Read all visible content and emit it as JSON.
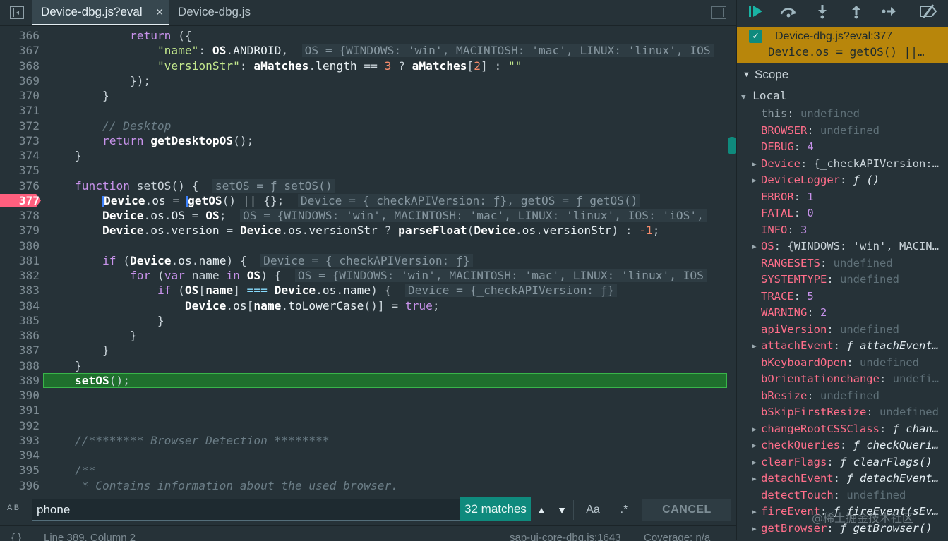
{
  "tabs": {
    "active": "Device-dbg.js?eval",
    "inactive": "Device-dbg.js",
    "close": "✕"
  },
  "editor": {
    "lines": [
      {
        "n": "366",
        "tokens": [
          [
            "pl",
            "            "
          ],
          [
            "kw",
            "return"
          ],
          [
            "pl",
            " ({"
          ]
        ]
      },
      {
        "n": "367",
        "tokens": [
          [
            "pl",
            "                "
          ],
          [
            "str",
            "\"name\""
          ],
          [
            "pl",
            ": "
          ],
          [
            "obj",
            "OS"
          ],
          [
            "pl",
            "."
          ],
          [
            "prop",
            "ANDROID"
          ],
          [
            "pl",
            ",  "
          ],
          [
            "inline",
            "OS = {WINDOWS: 'win', MACINTOSH: 'mac', LINUX: 'linux', IOS"
          ]
        ]
      },
      {
        "n": "368",
        "tokens": [
          [
            "pl",
            "                "
          ],
          [
            "str",
            "\"versionStr\""
          ],
          [
            "pl",
            ": "
          ],
          [
            "obj",
            "aMatches"
          ],
          [
            "pl",
            "."
          ],
          [
            "prop",
            "length"
          ],
          [
            "pl",
            " == "
          ],
          [
            "num",
            "3"
          ],
          [
            "pl",
            " ? "
          ],
          [
            "obj",
            "aMatches"
          ],
          [
            "pl",
            "["
          ],
          [
            "num",
            "2"
          ],
          [
            "pl",
            "] : "
          ],
          [
            "str",
            "\"\""
          ]
        ]
      },
      {
        "n": "369",
        "tokens": [
          [
            "pl",
            "            });"
          ]
        ]
      },
      {
        "n": "370",
        "tokens": [
          [
            "pl",
            "        }"
          ]
        ]
      },
      {
        "n": "371",
        "tokens": []
      },
      {
        "n": "372",
        "tokens": [
          [
            "pl",
            "        "
          ],
          [
            "cm",
            "// Desktop"
          ]
        ]
      },
      {
        "n": "373",
        "tokens": [
          [
            "pl",
            "        "
          ],
          [
            "kw",
            "return"
          ],
          [
            "pl",
            " "
          ],
          [
            "fn",
            "getDesktopOS"
          ],
          [
            "pl",
            "();"
          ]
        ]
      },
      {
        "n": "374",
        "tokens": [
          [
            "pl",
            "    }"
          ]
        ]
      },
      {
        "n": "375",
        "tokens": []
      },
      {
        "n": "376",
        "tokens": [
          [
            "pl",
            "    "
          ],
          [
            "kw",
            "function"
          ],
          [
            "pl",
            " setOS() {  "
          ],
          [
            "inline",
            "setOS = ƒ setOS()"
          ]
        ]
      },
      {
        "n": "377",
        "tokens": [
          [
            "pl",
            "        "
          ],
          [
            "cursor",
            ""
          ],
          [
            "obj",
            "Device"
          ],
          [
            "pl",
            "."
          ],
          [
            "prop",
            "os"
          ],
          [
            "pl",
            " = "
          ],
          [
            "cursor",
            ""
          ],
          [
            "fn",
            "getOS"
          ],
          [
            "pl",
            "() || {};  "
          ],
          [
            "inline",
            "Device = {_checkAPIVersion: ƒ}, getOS = ƒ getOS()"
          ]
        ]
      },
      {
        "n": "378",
        "tokens": [
          [
            "pl",
            "        "
          ],
          [
            "obj",
            "Device"
          ],
          [
            "pl",
            "."
          ],
          [
            "prop",
            "os"
          ],
          [
            "pl",
            "."
          ],
          [
            "prop",
            "OS"
          ],
          [
            "pl",
            " = "
          ],
          [
            "obj",
            "OS"
          ],
          [
            "pl",
            ";  "
          ],
          [
            "inline",
            "OS = {WINDOWS: 'win', MACINTOSH: 'mac', LINUX: 'linux', IOS: 'iOS',"
          ]
        ]
      },
      {
        "n": "379",
        "tokens": [
          [
            "pl",
            "        "
          ],
          [
            "obj",
            "Device"
          ],
          [
            "pl",
            "."
          ],
          [
            "prop",
            "os"
          ],
          [
            "pl",
            "."
          ],
          [
            "prop",
            "version"
          ],
          [
            "pl",
            " = "
          ],
          [
            "obj",
            "Device"
          ],
          [
            "pl",
            "."
          ],
          [
            "prop",
            "os"
          ],
          [
            "pl",
            "."
          ],
          [
            "prop",
            "versionStr"
          ],
          [
            "pl",
            " ? "
          ],
          [
            "fn",
            "parseFloat"
          ],
          [
            "pl",
            "("
          ],
          [
            "obj",
            "Device"
          ],
          [
            "pl",
            "."
          ],
          [
            "prop",
            "os"
          ],
          [
            "pl",
            "."
          ],
          [
            "prop",
            "versionStr"
          ],
          [
            "pl",
            ") : "
          ],
          [
            "num",
            "-1"
          ],
          [
            "pl",
            ";"
          ]
        ]
      },
      {
        "n": "380",
        "tokens": []
      },
      {
        "n": "381",
        "tokens": [
          [
            "pl",
            "        "
          ],
          [
            "kw",
            "if"
          ],
          [
            "pl",
            " ("
          ],
          [
            "obj",
            "Device"
          ],
          [
            "pl",
            "."
          ],
          [
            "prop",
            "os"
          ],
          [
            "pl",
            "."
          ],
          [
            "prop",
            "name"
          ],
          [
            "pl",
            ") {  "
          ],
          [
            "inline",
            "Device = {_checkAPIVersion: ƒ}"
          ]
        ]
      },
      {
        "n": "382",
        "tokens": [
          [
            "pl",
            "            "
          ],
          [
            "kw",
            "for"
          ],
          [
            "pl",
            " ("
          ],
          [
            "kw",
            "var"
          ],
          [
            "pl",
            " name "
          ],
          [
            "kw",
            "in"
          ],
          [
            "pl",
            " "
          ],
          [
            "obj",
            "OS"
          ],
          [
            "pl",
            ") {  "
          ],
          [
            "inline",
            "OS = {WINDOWS: 'win', MACINTOSH: 'mac', LINUX: 'linux', IOS"
          ]
        ]
      },
      {
        "n": "383",
        "tokens": [
          [
            "pl",
            "                "
          ],
          [
            "kw",
            "if"
          ],
          [
            "pl",
            " ("
          ],
          [
            "obj",
            "OS"
          ],
          [
            "pl",
            "["
          ],
          [
            "obj",
            "name"
          ],
          [
            "pl",
            "] "
          ],
          [
            "pr",
            "==="
          ],
          [
            "pl",
            " "
          ],
          [
            "obj",
            "Device"
          ],
          [
            "pl",
            "."
          ],
          [
            "prop",
            "os"
          ],
          [
            "pl",
            "."
          ],
          [
            "prop",
            "name"
          ],
          [
            "pl",
            ") {  "
          ],
          [
            "inline",
            "Device = {_checkAPIVersion: ƒ}"
          ]
        ]
      },
      {
        "n": "384",
        "tokens": [
          [
            "pl",
            "                    "
          ],
          [
            "obj",
            "Device"
          ],
          [
            "pl",
            "."
          ],
          [
            "prop",
            "os"
          ],
          [
            "pl",
            "["
          ],
          [
            "obj",
            "name"
          ],
          [
            "pl",
            "."
          ],
          [
            "prop",
            "toLowerCase"
          ],
          [
            "pl",
            "()] = "
          ],
          [
            "kw",
            "true"
          ],
          [
            "pl",
            ";"
          ]
        ]
      },
      {
        "n": "385",
        "tokens": [
          [
            "pl",
            "                }"
          ]
        ]
      },
      {
        "n": "386",
        "tokens": [
          [
            "pl",
            "            }"
          ]
        ]
      },
      {
        "n": "387",
        "tokens": [
          [
            "pl",
            "        }"
          ]
        ]
      },
      {
        "n": "388",
        "tokens": [
          [
            "pl",
            "    }"
          ]
        ]
      },
      {
        "n": "389",
        "tokens": [
          [
            "pl",
            "    "
          ],
          [
            "fn",
            "setOS"
          ],
          [
            "pl",
            "();"
          ]
        ]
      },
      {
        "n": "390",
        "tokens": []
      },
      {
        "n": "391",
        "tokens": []
      },
      {
        "n": "392",
        "tokens": []
      },
      {
        "n": "393",
        "tokens": [
          [
            "pl",
            "    "
          ],
          [
            "cm",
            "//******** Browser Detection ********"
          ]
        ]
      },
      {
        "n": "394",
        "tokens": []
      },
      {
        "n": "395",
        "tokens": [
          [
            "pl",
            "    "
          ],
          [
            "cm",
            "/**"
          ]
        ]
      },
      {
        "n": "396",
        "tokens": [
          [
            "pl",
            "     "
          ],
          [
            "cm",
            "* Contains information about the used browser."
          ]
        ]
      }
    ],
    "breakpoint_line": "377",
    "paused_line": "389"
  },
  "search": {
    "icon": "A B",
    "value": "phone",
    "matches": "32 matches",
    "prev": "▲",
    "next": "▼",
    "case": "Aa",
    "regex": ".*",
    "cancel": "CANCEL"
  },
  "status": {
    "braces": "{ }",
    "position": "Line 389, Column 2",
    "source": "sap-ui-core-dbg.js:1643",
    "coverage": "Coverage: n/a"
  },
  "debugger": {
    "breakpoint_title": "Device-dbg.js?eval:377",
    "breakpoint_code": "Device.os = getOS() ||…",
    "scope_label": "Scope",
    "local_label": "Local",
    "vars": [
      {
        "name": "this",
        "value": "undefined",
        "kind": "undef",
        "expand": false,
        "this": true
      },
      {
        "name": "BROWSER",
        "value": "undefined",
        "kind": "undef",
        "expand": false
      },
      {
        "name": "DEBUG",
        "value": "4",
        "kind": "num",
        "expand": false
      },
      {
        "name": "Device",
        "value": "{_checkAPIVersion:…",
        "kind": "obj",
        "expand": true
      },
      {
        "name": "DeviceLogger",
        "value": "ƒ ()",
        "kind": "fn",
        "expand": true
      },
      {
        "name": "ERROR",
        "value": "1",
        "kind": "num",
        "expand": false
      },
      {
        "name": "FATAL",
        "value": "0",
        "kind": "num",
        "expand": false
      },
      {
        "name": "INFO",
        "value": "3",
        "kind": "num",
        "expand": false
      },
      {
        "name": "OS",
        "value": "{WINDOWS: 'win', MACIN…",
        "kind": "obj",
        "expand": true
      },
      {
        "name": "RANGESETS",
        "value": "undefined",
        "kind": "undef",
        "expand": false
      },
      {
        "name": "SYSTEMTYPE",
        "value": "undefined",
        "kind": "undef",
        "expand": false
      },
      {
        "name": "TRACE",
        "value": "5",
        "kind": "num",
        "expand": false
      },
      {
        "name": "WARNING",
        "value": "2",
        "kind": "num",
        "expand": false
      },
      {
        "name": "apiVersion",
        "value": "undefined",
        "kind": "undef",
        "expand": false
      },
      {
        "name": "attachEvent",
        "value": "ƒ attachEvent…",
        "kind": "fn",
        "expand": true
      },
      {
        "name": "bKeyboardOpen",
        "value": "undefined",
        "kind": "undef",
        "expand": false
      },
      {
        "name": "bOrientationchange",
        "value": "undefi…",
        "kind": "undef",
        "expand": false
      },
      {
        "name": "bResize",
        "value": "undefined",
        "kind": "undef",
        "expand": false
      },
      {
        "name": "bSkipFirstResize",
        "value": "undefined",
        "kind": "undef",
        "expand": false
      },
      {
        "name": "changeRootCSSClass",
        "value": "ƒ chan…",
        "kind": "fn",
        "expand": true
      },
      {
        "name": "checkQueries",
        "value": "ƒ checkQueri…",
        "kind": "fn",
        "expand": true
      },
      {
        "name": "clearFlags",
        "value": "ƒ clearFlags()",
        "kind": "fn",
        "expand": true
      },
      {
        "name": "detachEvent",
        "value": "ƒ detachEvent…",
        "kind": "fn",
        "expand": true
      },
      {
        "name": "detectTouch",
        "value": "undefined",
        "kind": "undef",
        "expand": false
      },
      {
        "name": "fireEvent",
        "value": "ƒ fireEvent(sEv…",
        "kind": "fn",
        "expand": true
      },
      {
        "name": "getBrowser",
        "value": "ƒ getBrowser()",
        "kind": "fn",
        "expand": true
      }
    ]
  },
  "watermark": "@稀土掘金技术社区",
  "colors": {
    "accent": "#0f8a7d",
    "breakpoint": "#ff5f7e",
    "paused_line": "#1f6f2d",
    "banner": "#b8860b"
  }
}
